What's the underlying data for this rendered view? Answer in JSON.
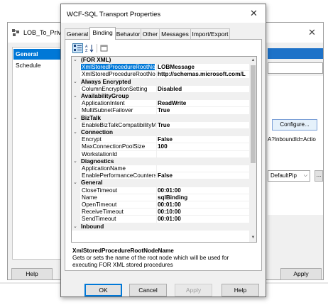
{
  "background_window": {
    "title": "LOB_To_Private",
    "nav_items": [
      "General",
      "Schedule"
    ],
    "configure_label": "Configure...",
    "uri_fragment": "A?InboundId=Actio",
    "pipeline_value": "DefaultPip",
    "dots_label": "...",
    "help_label": "Help",
    "apply_label": "Apply"
  },
  "dialog": {
    "title": "WCF-SQL Transport Properties",
    "tabs": [
      "General",
      "Binding",
      "Behavior",
      "Other",
      "Messages",
      "Import/Export"
    ],
    "active_tab": "Binding",
    "toolbar": {
      "categorized_icon": "categorized-icon",
      "alphabetical_icon": "alphabetical-icon",
      "property-pages_icon": "property-pages-icon"
    },
    "grid": {
      "rows": [
        {
          "type": "category",
          "name": "(FOR XML)"
        },
        {
          "type": "prop",
          "name": "XmlStoredProcedureRootNodeN",
          "value": "LOBMessage",
          "selected": true
        },
        {
          "type": "prop",
          "name": "XmlStoredProcedureRootNodeN",
          "value": "http://schemas.microsoft.com/L"
        },
        {
          "type": "category",
          "name": "Always Encrypted"
        },
        {
          "type": "prop",
          "name": "ColumnEncryptionSetting",
          "value": "Disabled"
        },
        {
          "type": "category",
          "name": "AvailabilityGroup"
        },
        {
          "type": "prop",
          "name": "ApplicationIntent",
          "value": "ReadWrite"
        },
        {
          "type": "prop",
          "name": "MultiSubnetFailover",
          "value": "True"
        },
        {
          "type": "category",
          "name": "BizTalk"
        },
        {
          "type": "prop",
          "name": "EnableBizTalkCompatibilityMode",
          "value": "True"
        },
        {
          "type": "category",
          "name": "Connection"
        },
        {
          "type": "prop",
          "name": "Encrypt",
          "value": "False"
        },
        {
          "type": "prop",
          "name": "MaxConnectionPoolSize",
          "value": "100"
        },
        {
          "type": "prop",
          "name": "WorkstationId",
          "value": ""
        },
        {
          "type": "category",
          "name": "Diagnostics"
        },
        {
          "type": "prop",
          "name": "ApplicationName",
          "value": ""
        },
        {
          "type": "prop",
          "name": "EnablePerformanceCounters",
          "value": "False"
        },
        {
          "type": "category",
          "name": "General"
        },
        {
          "type": "prop",
          "name": "CloseTimeout",
          "value": "00:01:00"
        },
        {
          "type": "prop",
          "name": "Name",
          "value": "sqlBinding"
        },
        {
          "type": "prop",
          "name": "OpenTimeout",
          "value": "00:01:00"
        },
        {
          "type": "prop",
          "name": "ReceiveTimeout",
          "value": "00:10:00"
        },
        {
          "type": "prop",
          "name": "SendTimeout",
          "value": "00:01:00"
        },
        {
          "type": "category",
          "name": "Inbound"
        }
      ]
    },
    "help": {
      "title": "XmlStoredProcedureRootNodeName",
      "text": "Gets or sets the name of the root node which will be used for executing FOR XML stored procedures"
    },
    "buttons": {
      "ok": "OK",
      "cancel": "Cancel",
      "apply": "Apply",
      "help": "Help"
    }
  }
}
